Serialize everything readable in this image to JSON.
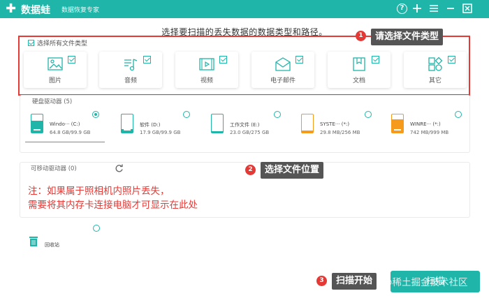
{
  "app": {
    "logo_symbol": "✚",
    "name": "数据蛙",
    "subtitle": "数据恢复专家"
  },
  "titlebar_icons": [
    "help-icon",
    "plus-icon",
    "menu-icon",
    "minimize-icon",
    "close-icon"
  ],
  "headline": "选择要扫描的丢失数据的数据类型和路径。",
  "file_types": {
    "select_all_label": "选择所有文件类型",
    "items": [
      {
        "label": "图片",
        "icon": "image-icon",
        "checked": true
      },
      {
        "label": "音频",
        "icon": "audio-icon",
        "checked": true
      },
      {
        "label": "视频",
        "icon": "video-icon",
        "checked": true
      },
      {
        "label": "电子邮件",
        "icon": "email-icon",
        "checked": true
      },
      {
        "label": "文档",
        "icon": "document-icon",
        "checked": true
      },
      {
        "label": "其它",
        "icon": "other-icon",
        "checked": true
      }
    ]
  },
  "callouts": [
    {
      "number": "1",
      "text": "请选择文件类型"
    },
    {
      "number": "2",
      "text": "选择文件位置"
    },
    {
      "number": "3",
      "text": "扫描开始"
    }
  ],
  "disks": {
    "section_label": "硬盘驱动器 (5)",
    "items": [
      {
        "name": "Windo··· (C:)",
        "size": "64.8 GB/99.9 GB",
        "used_fraction": 0.65,
        "color": "#1fb5a9",
        "selected": true
      },
      {
        "name": "软件 (D:)",
        "size": "17.9 GB/99.9 GB",
        "used_fraction": 0.18,
        "color": "#1fb5a9",
        "selected": false
      },
      {
        "name": "工作文件 (E:)",
        "size": "23.0 GB/275 GB",
        "used_fraction": 0.08,
        "color": "#1fb5a9",
        "selected": false
      },
      {
        "name": "SYSTE··· (*:)",
        "size": "29.8 MB/256 MB",
        "used_fraction": 0.12,
        "color": "#f59a1b",
        "selected": false
      },
      {
        "name": "WINRE··· (*:)",
        "size": "742 MB/999 MB",
        "used_fraction": 0.74,
        "color": "#f59a1b",
        "selected": false
      }
    ]
  },
  "removable": {
    "section_label": "可移动驱动器 (0)",
    "note_line1": "注：如果属于照相机内照片丢失，",
    "note_line2": "需要将其内存卡连接电脑才可显示在此处"
  },
  "recycle_bin": {
    "label": "回收站",
    "selected": false
  },
  "scan_button": {
    "label": "扫描"
  },
  "watermark": "@稀土掘金技术社区",
  "colors": {
    "accent": "#1fb5a9",
    "warning": "#f59a1b",
    "annotation_red": "#e53935"
  }
}
